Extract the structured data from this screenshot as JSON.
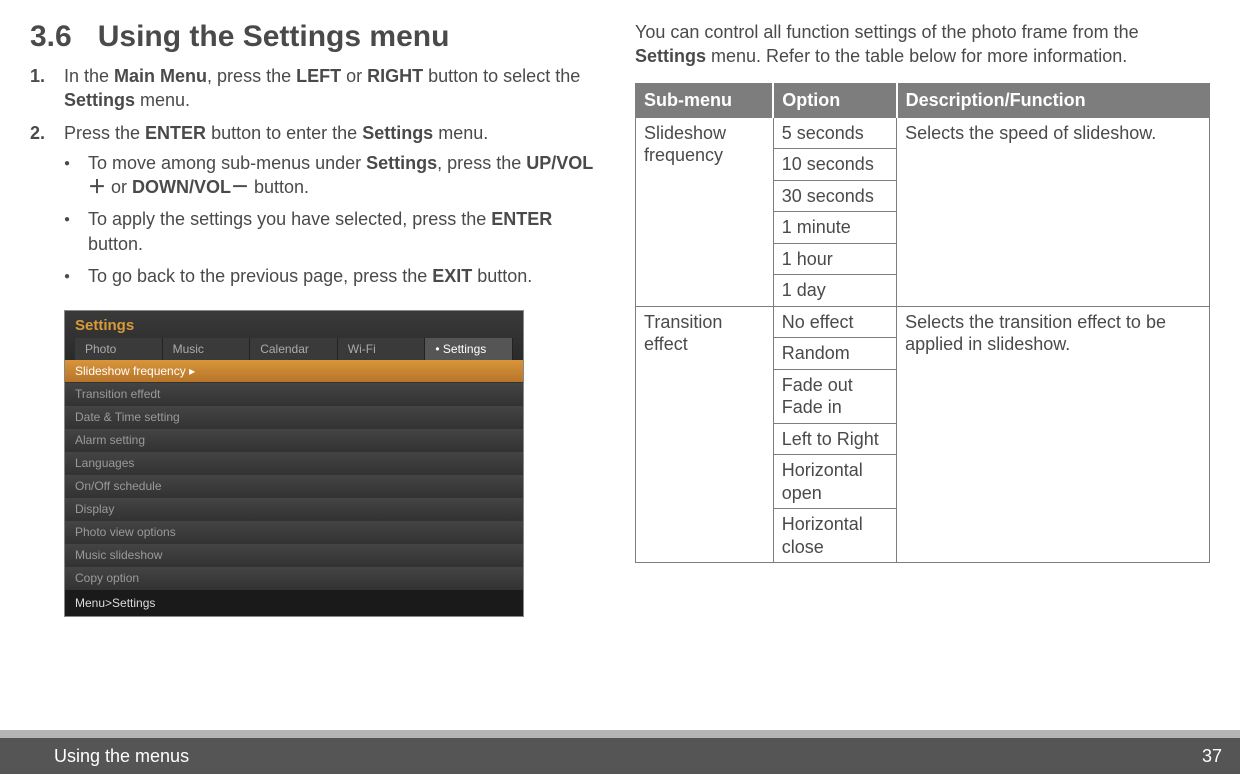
{
  "section": {
    "number": "3.6",
    "title": "Using the Settings menu"
  },
  "steps": {
    "s1": {
      "num": "1.",
      "p1": "In the ",
      "b1": "Main Menu",
      "p2": ", press the ",
      "b2": "LEFT",
      "p3": " or ",
      "b3": "RIGHT",
      "p4": " button to select the ",
      "b4": "Settings",
      "p5": " menu."
    },
    "s2": {
      "num": "2.",
      "p1": "Press the ",
      "b1": "ENTER",
      "p2": " button to enter the ",
      "b2": "Settings",
      "p3": " menu."
    },
    "bul1": {
      "p1": "To move among sub-menus under ",
      "b1": "Settings",
      "p2": ", press the ",
      "b2": "UP/VOL＋",
      "p3": " or ",
      "b3": "DOWN/VOL－",
      "p4": " button."
    },
    "bul2": {
      "p1": "To apply the settings you have selected, press the ",
      "b1": "ENTER",
      "p2": " button."
    },
    "bul3": {
      "p1": "To go back to the previous page, press the ",
      "b1": "EXIT",
      "p2": " button."
    }
  },
  "screenshot": {
    "title": "Settings",
    "tabs": [
      "Photo",
      "Music",
      "Calendar",
      "Wi-Fi",
      "Settings"
    ],
    "rows": [
      "Slideshow frequency",
      "Transition effedt",
      "Date & Time setting",
      "Alarm setting",
      "Languages",
      "On/Off schedule",
      "Display",
      "Photo view options",
      "Music slideshow",
      "Copy option"
    ],
    "breadcrumb": "Menu>Settings"
  },
  "intro": {
    "p1": "You can control all function settings of the photo frame from the ",
    "b1": "Settings",
    "p2": " menu. Refer to the table below for more information."
  },
  "table": {
    "headers": {
      "h1": "Sub-menu",
      "h2": "Option",
      "h3": "Description/Function"
    },
    "g1": {
      "sub": "Slideshow frequency",
      "opts": [
        "5 seconds",
        "10 seconds",
        "30 seconds",
        "1 minute",
        "1 hour",
        "1 day"
      ],
      "desc": "Selects the speed of slideshow."
    },
    "g2": {
      "sub": "Transition effect",
      "opts": [
        "No effect",
        "Random",
        "Fade out Fade in",
        "Left to Right",
        "Horizontal open",
        "Horizontal close"
      ],
      "desc": "Selects the transition effect to be applied in slideshow."
    }
  },
  "footer": {
    "left": "Using the menus",
    "right": "37"
  }
}
